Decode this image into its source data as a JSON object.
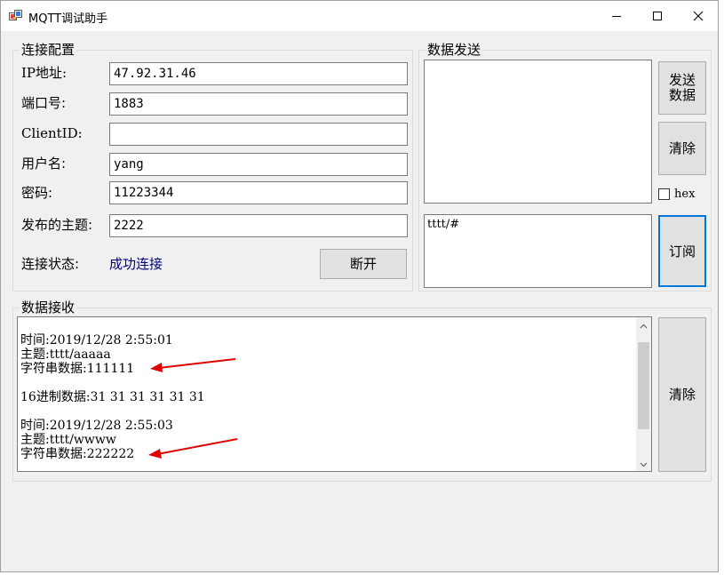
{
  "window": {
    "title": "MQTT调试助手",
    "minimize_icon": "minimize-icon",
    "maximize_icon": "maximize-icon",
    "close_icon": "close-icon"
  },
  "connection": {
    "group_title": "连接配置",
    "ip_label": "IP地址:",
    "ip_value": "47.92.31.46",
    "port_label": "端口号:",
    "port_value": "1883",
    "client_id_label": "ClientID:",
    "client_id_value": "",
    "username_label": "用户名:",
    "username_value": "yang",
    "password_label": "密码:",
    "password_value": "11223344",
    "publish_topic_label": "发布的主题:",
    "publish_topic_value": "2222",
    "status_label": "连接状态:",
    "status_value": "成功连接",
    "disconnect_button": "断开"
  },
  "send": {
    "group_title": "数据发送",
    "send_button": "发送\n数据",
    "clear_button": "清除",
    "hex_label": "hex",
    "hex_checked": false,
    "send_text": "",
    "subscribe_topic": "tttt/#",
    "subscribe_button": "订阅"
  },
  "receive": {
    "group_title": "数据接收",
    "clear_button": "清除",
    "lines": [
      "时间:2019/12/28 2:55:01",
      "主题:tttt/aaaaa",
      "字符串数据:111111",
      "",
      "16进制数据:31 31 31 31 31 31",
      "",
      "时间:2019/12/28 2:55:03",
      "主题:tttt/wwww",
      "字符串数据:222222"
    ]
  },
  "colors": {
    "accent": "#0078d7",
    "status_ok": "#000080",
    "annotation_arrow": "#e00000"
  }
}
